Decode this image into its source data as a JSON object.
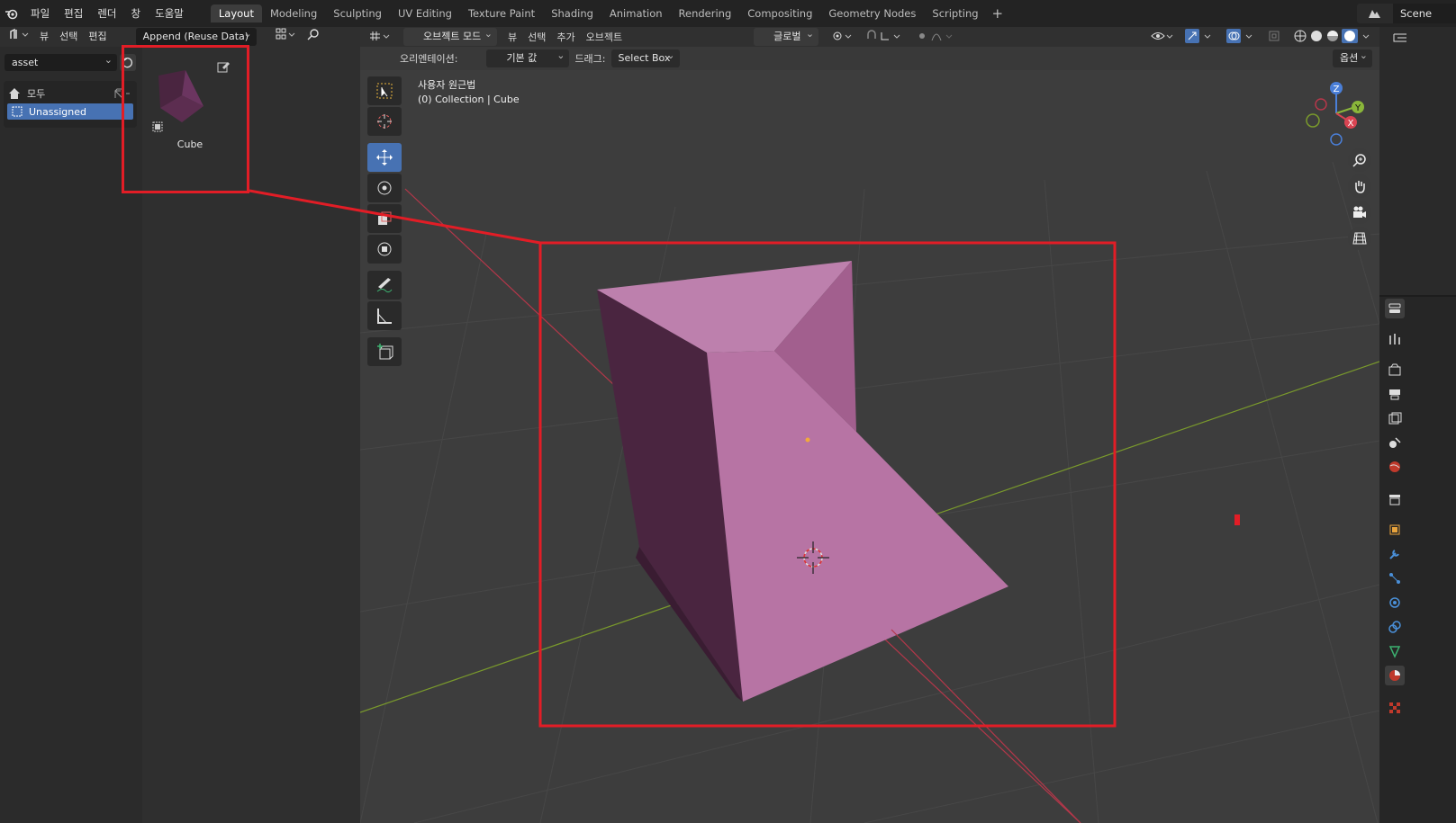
{
  "menu": {
    "items": [
      "파일",
      "편집",
      "렌더",
      "창",
      "도움말"
    ]
  },
  "workspaces": {
    "tabs": [
      "Layout",
      "Modeling",
      "Sculpting",
      "UV Editing",
      "Texture Paint",
      "Shading",
      "Animation",
      "Rendering",
      "Compositing",
      "Geometry Nodes",
      "Scripting"
    ],
    "active": "Layout",
    "add_label": "+"
  },
  "scene": {
    "name": "Scene"
  },
  "asset_browser": {
    "header": {
      "view": "뷰",
      "select": "선택",
      "edit": "편집",
      "import_mode": "Append (Reuse Data)"
    },
    "library": "asset",
    "catalogs": {
      "all": "모두",
      "unassigned": "Unassigned"
    },
    "assets": [
      {
        "name": "Cube"
      }
    ]
  },
  "viewport": {
    "header": {
      "mode": "오브젝트 모드",
      "view": "뷰",
      "select": "선택",
      "add": "추가",
      "object": "오브젝트",
      "transform_orientation": "글로벌"
    },
    "subheader": {
      "orientation_label": "오리엔테이션:",
      "orientation_value": "기본 값",
      "drag_label": "드래그:",
      "drag_value": "Select Box",
      "options": "옵션"
    },
    "overlay": {
      "projection": "사용자 원근법",
      "collection": "(0) Collection | Cube"
    },
    "gizmo": {
      "z": "Z",
      "y": "Y",
      "x": "X"
    }
  },
  "colors": {
    "accent": "#4772b3",
    "mesh_light": "#b87aa8",
    "mesh_dark": "#4a2540",
    "highlight_box": "#e21d26",
    "x_axis": "#b5374a",
    "y_axis": "#7a9a2c"
  },
  "icons": {
    "tools": [
      "select-box-icon",
      "cursor-icon",
      "move-icon",
      "rotate-icon",
      "scale-icon",
      "transform-icon",
      "annotate-icon",
      "measure-icon",
      "add-cube-icon"
    ],
    "navigation": [
      "zoom-icon",
      "pan-hand-icon",
      "camera-icon",
      "grid-view-icon"
    ],
    "properties": [
      "tool-icon",
      "render-icon",
      "output-icon",
      "view-layer-icon",
      "scene-icon",
      "world-icon",
      "collection-icon",
      "object-icon",
      "modifier-icon",
      "particles-icon",
      "physics-icon",
      "constraints-icon",
      "data-icon",
      "material-icon",
      "texture-icon"
    ]
  }
}
